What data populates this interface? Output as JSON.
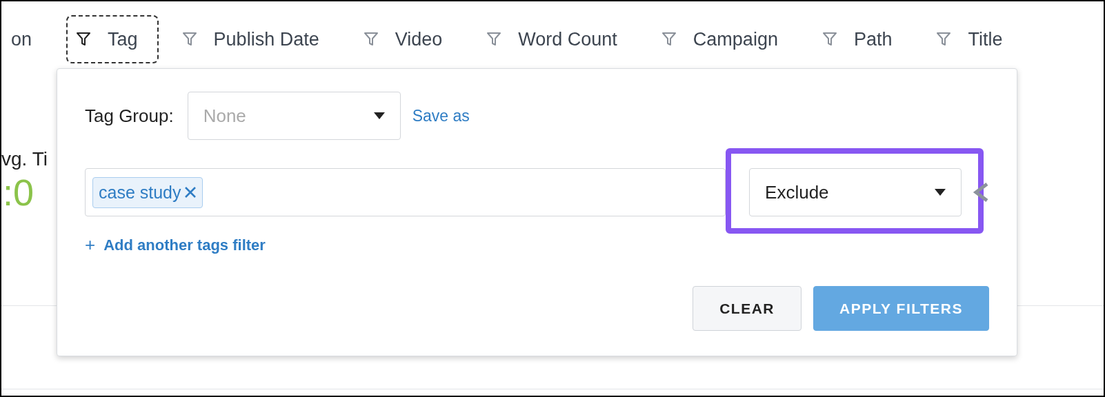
{
  "tabs": [
    {
      "label": "on",
      "kind": "plain",
      "selected": false
    },
    {
      "label": "Tag",
      "kind": "filter",
      "selected": true
    },
    {
      "label": "Publish Date",
      "kind": "filter",
      "selected": false
    },
    {
      "label": "Video",
      "kind": "filter",
      "selected": false
    },
    {
      "label": "Word Count",
      "kind": "filter",
      "selected": false
    },
    {
      "label": "Campaign",
      "kind": "filter",
      "selected": false
    },
    {
      "label": "Path",
      "kind": "filter",
      "selected": false
    },
    {
      "label": "Title",
      "kind": "filter",
      "selected": false
    }
  ],
  "metric": {
    "label": "vg. Ti",
    "value": ":0"
  },
  "popup": {
    "tag_group_label": "Tag Group:",
    "tag_group_select": {
      "placeholder": "None"
    },
    "save_link": "Save as",
    "filters": [
      {
        "tags": [
          "case study"
        ],
        "mode": "Exclude",
        "highlighted": true
      }
    ],
    "add_link": {
      "icon": "+",
      "label": "Add another tags filter"
    },
    "buttons": [
      {
        "label": "CLEAR",
        "kind": "secondary"
      },
      {
        "label": "APPLY FILTERS",
        "kind": "primary"
      }
    ]
  }
}
